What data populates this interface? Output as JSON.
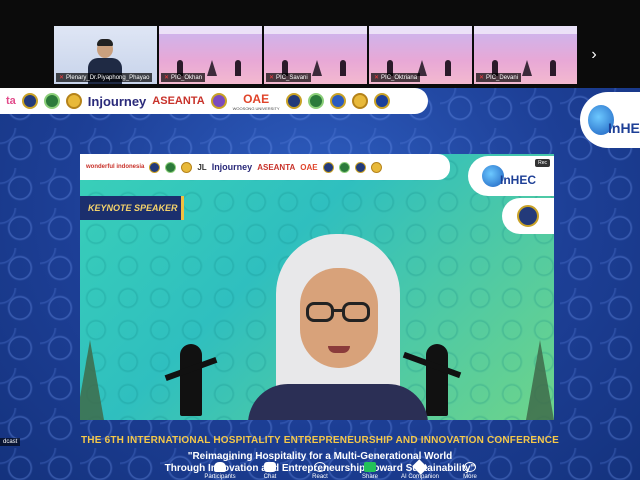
{
  "participants_strip": {
    "tiles": [
      {
        "name": "Plenary_Dr.Piyaphong_Phayao",
        "type": "speaker"
      },
      {
        "name": "PIC_Okhan",
        "type": "slide"
      },
      {
        "name": "PIC_Savani",
        "type": "slide"
      },
      {
        "name": "PIC_Oktriana",
        "type": "slide"
      },
      {
        "name": "PIC_Devani",
        "type": "slide"
      }
    ],
    "next_arrow": "›"
  },
  "slide": {
    "logos": [
      "ta",
      "Injourney",
      "ASEANTA",
      "OAE"
    ],
    "logo_caption": "WOOSONG UNIVERSITY",
    "brand": "InHEC",
    "panel_logos": [
      "wonderful indonesia",
      "JL",
      "Injourney",
      "ASEANTA",
      "OAE"
    ],
    "panel_brand": "InHEC",
    "rec_tag": "Rec",
    "keynote_label": "KEYNOTE SPEAKER"
  },
  "conference": {
    "title": "THE 6TH INTERNATIONAL HOSPITALITY ENTREPRENEURSHIP AND INNOVATION CONFERENCE",
    "subtitle_line1": "\"Reimagining Hospitality for a Multi-Generational World",
    "subtitle_line2": "Through Innovation and Entrepreneurship Toward Sustainability\""
  },
  "side_label": "dcast",
  "toolbar": {
    "participants_label": "Participants",
    "participants_count": "115",
    "chat_label": "Chat",
    "react_label": "React",
    "share_label": "Share",
    "ai_label": "AI Companion",
    "more_label": "More"
  },
  "colors": {
    "accent_gold": "#f4c84a",
    "share_green": "#23c15a",
    "slide_blue": "#1d3f96"
  }
}
